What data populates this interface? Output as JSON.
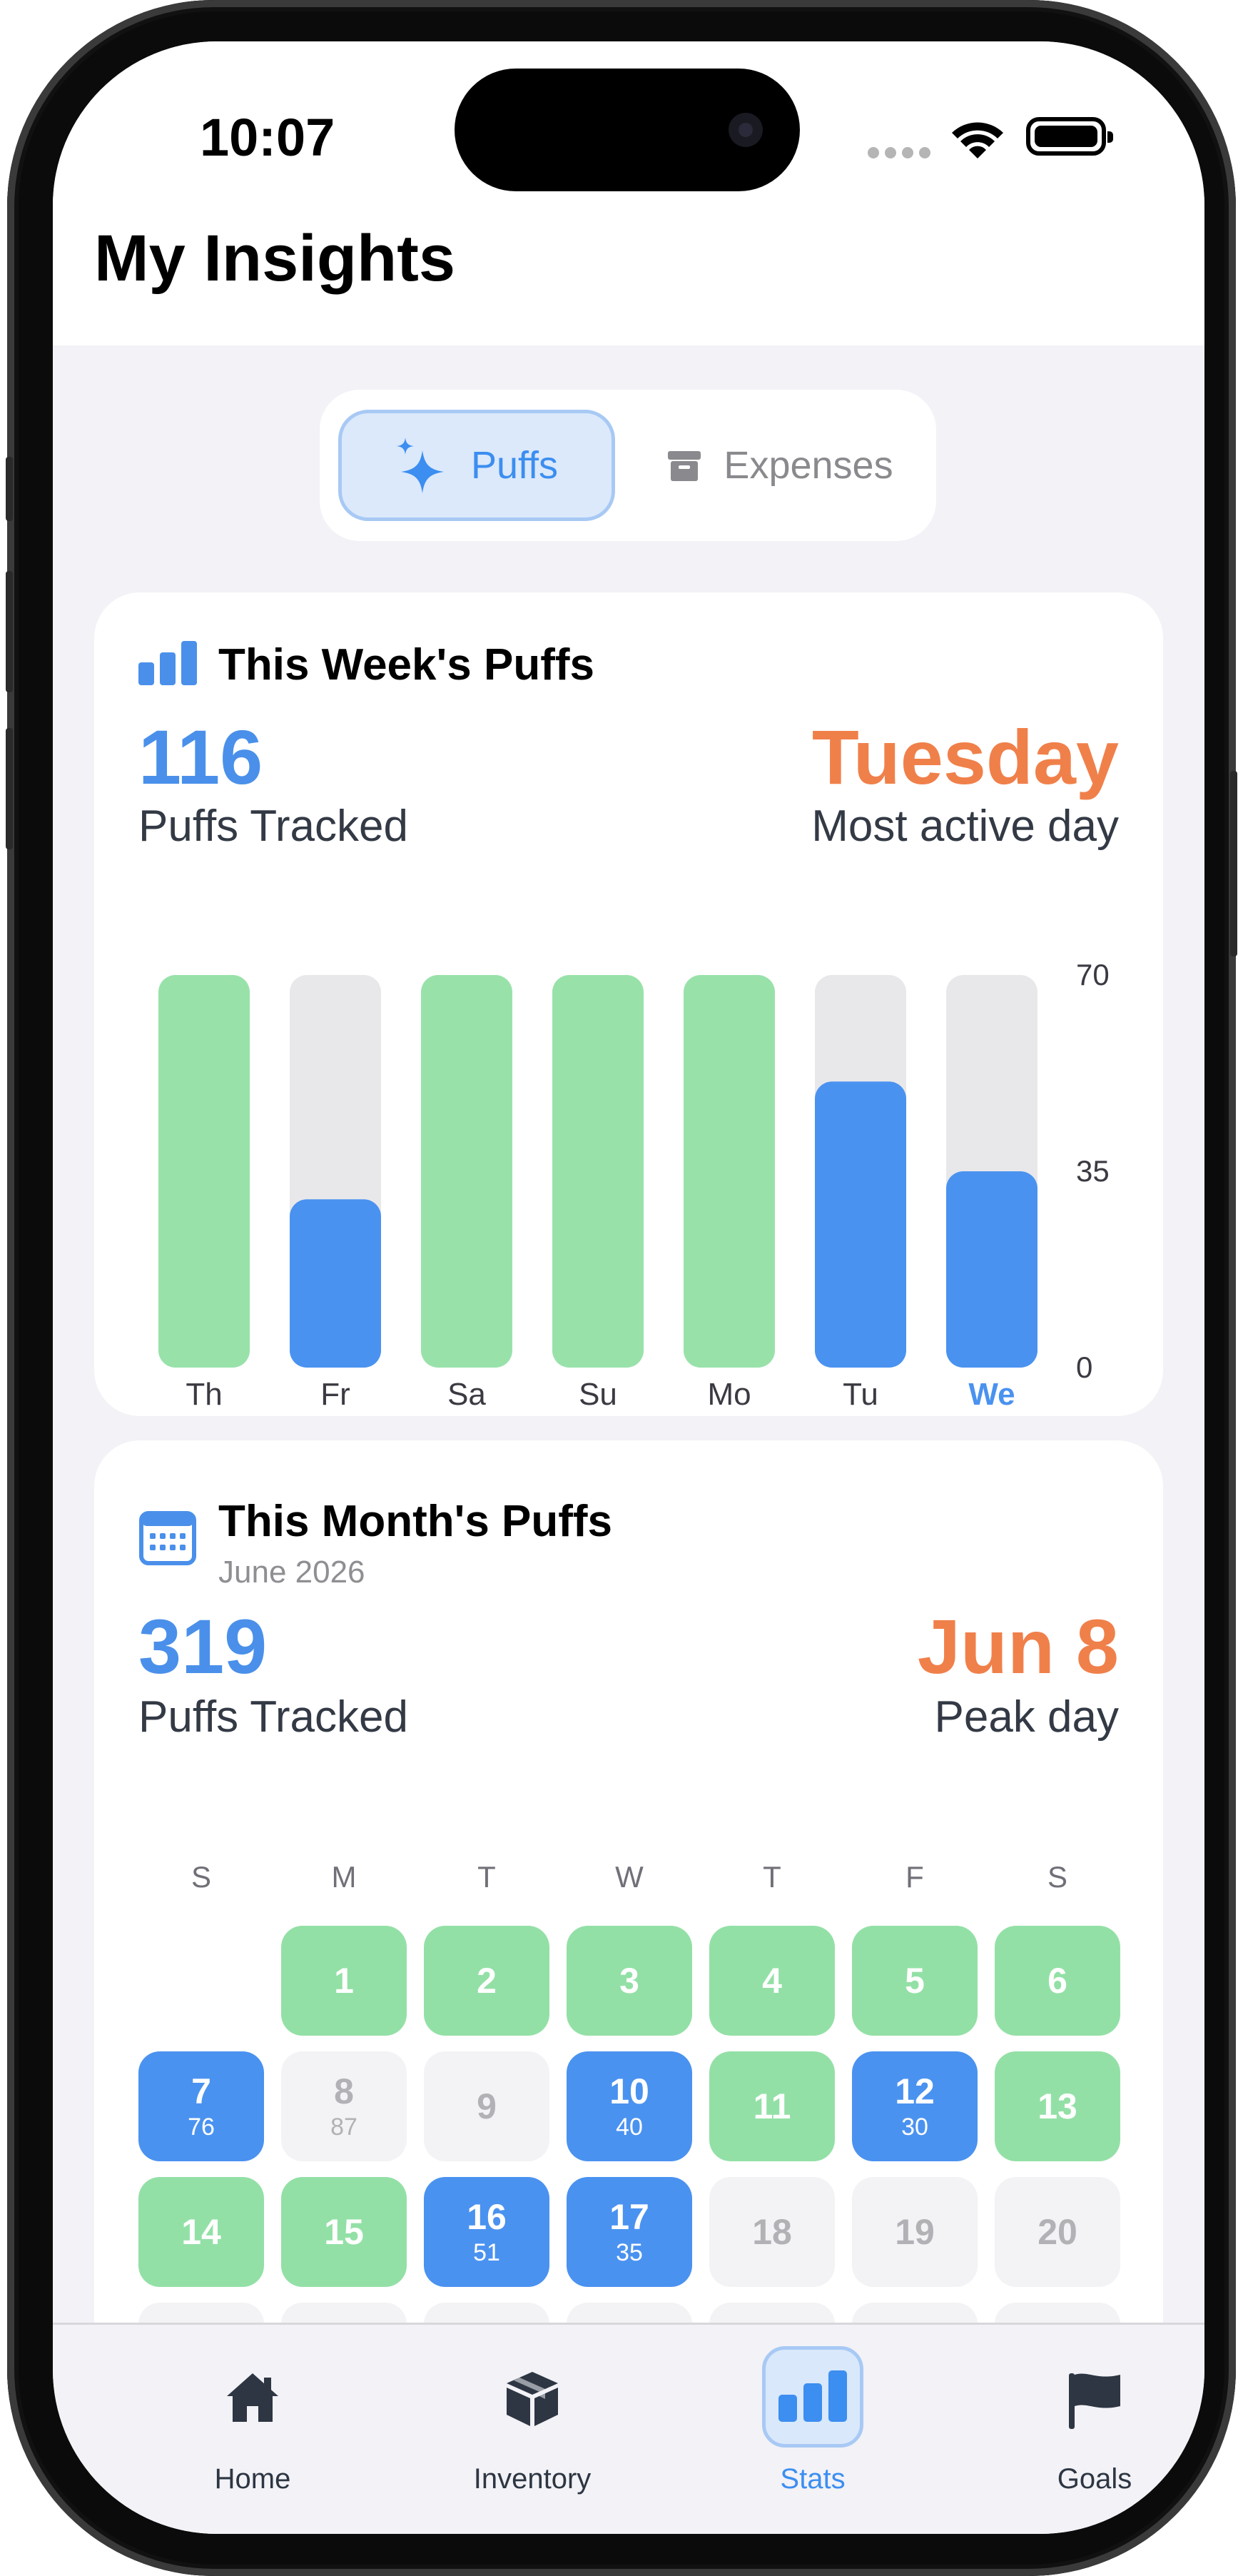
{
  "status_bar": {
    "time": "10:07"
  },
  "header": {
    "title": "My Insights"
  },
  "segment": {
    "puffs_label": "Puffs",
    "expenses_label": "Expenses"
  },
  "week_card": {
    "title": "This Week's Puffs",
    "total": "116",
    "total_label": "Puffs Tracked",
    "active_day": "Tuesday",
    "active_day_label": "Most active day"
  },
  "chart_data": {
    "type": "bar",
    "categories": [
      "Th",
      "Fr",
      "Sa",
      "Su",
      "Mo",
      "Tu",
      "We"
    ],
    "values": [
      70,
      30,
      70,
      70,
      70,
      51,
      35
    ],
    "ylim": [
      0,
      70
    ],
    "yticks": [
      "70",
      "35",
      "0"
    ],
    "highlight_category": "We",
    "colors": {
      "over_limit": "#98e2aa",
      "under_limit": "#4a92f0",
      "track": "#e8e8ea",
      "today": "#4a92f0"
    }
  },
  "month_card": {
    "title": "This Month's Puffs",
    "subtitle": "June 2026",
    "total": "319",
    "total_label": "Puffs Tracked",
    "peak_day": "Jun 8",
    "peak_label": "Peak day",
    "weekdays": [
      "S",
      "M",
      "T",
      "W",
      "T",
      "F",
      "S"
    ],
    "days": [
      {
        "day": "1",
        "value": "",
        "status": "green"
      },
      {
        "day": "2",
        "value": "",
        "status": "green"
      },
      {
        "day": "3",
        "value": "",
        "status": "green"
      },
      {
        "day": "4",
        "value": "",
        "status": "green"
      },
      {
        "day": "5",
        "value": "",
        "status": "green"
      },
      {
        "day": "6",
        "value": "",
        "status": "green"
      },
      {
        "day": "7",
        "value": "76",
        "status": "blue"
      },
      {
        "day": "8",
        "value": "87",
        "status": "gray"
      },
      {
        "day": "9",
        "value": "",
        "status": "gray"
      },
      {
        "day": "10",
        "value": "40",
        "status": "blue"
      },
      {
        "day": "11",
        "value": "",
        "status": "green"
      },
      {
        "day": "12",
        "value": "30",
        "status": "blue"
      },
      {
        "day": "13",
        "value": "",
        "status": "green"
      },
      {
        "day": "14",
        "value": "",
        "status": "green"
      },
      {
        "day": "15",
        "value": "",
        "status": "green"
      },
      {
        "day": "16",
        "value": "51",
        "status": "blue"
      },
      {
        "day": "17",
        "value": "35",
        "status": "blue"
      },
      {
        "day": "18",
        "value": "",
        "status": "gray"
      },
      {
        "day": "19",
        "value": "",
        "status": "gray"
      },
      {
        "day": "20",
        "value": "",
        "status": "gray"
      }
    ]
  },
  "tabbar": {
    "home": "Home",
    "inventory": "Inventory",
    "stats": "Stats",
    "goals": "Goals",
    "active": "stats"
  }
}
